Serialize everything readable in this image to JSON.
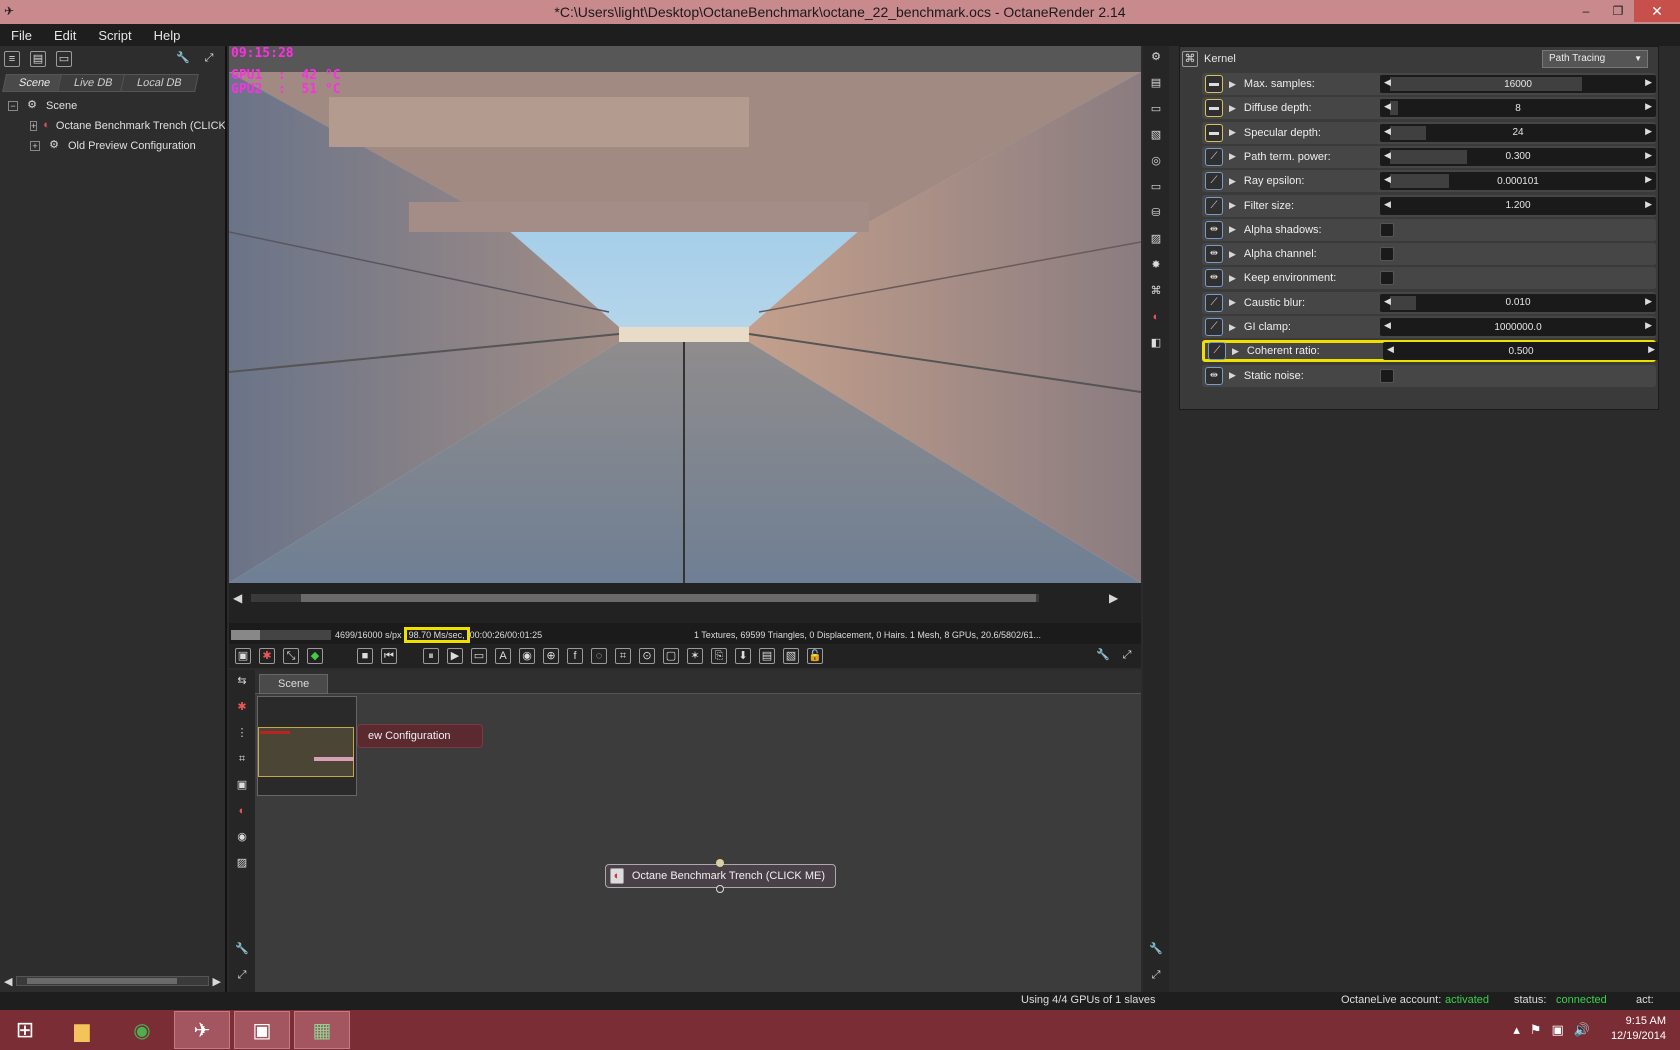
{
  "window": {
    "title": "*C:\\Users\\light\\Desktop\\OctaneBenchmark\\octane_22_benchmark.ocs - OctaneRender 2.14",
    "minimize": "‒",
    "maximize": "❐",
    "close": "✕"
  },
  "menu": [
    "File",
    "Edit",
    "Script",
    "Help"
  ],
  "left_panel": {
    "tabs": [
      "Scene",
      "Live DB",
      "Local DB"
    ],
    "tree": [
      {
        "expander": "−",
        "label": "Scene"
      },
      {
        "expander": "+",
        "label": "Octane Benchmark Trench (CLICK ME)"
      },
      {
        "expander": "+",
        "label": "Old Preview Configuration"
      }
    ]
  },
  "viewer": {
    "hud_time": "09:15:28",
    "hud_gpu1": "GPU1  :  42 °C",
    "hud_gpu2": "GPU2  :  51 °C",
    "progress": 0.294,
    "samples_text": "4699/16000 s/px",
    "speed_text": "98.70 Ms/sec,",
    "time_text": "00:00:26/00:01:25",
    "scene_stats": "1 Textures, 69599 Triangles, 0 Displacement, 0 Hairs. 1 Mesh, 8 GPUs, 20.6/5802/61..."
  },
  "node_graph": {
    "tab": "Scene",
    "node_preview_config": "ew Configuration",
    "node_main": "Octane Benchmark Trench (CLICK ME)"
  },
  "kernel": {
    "title": "Kernel",
    "type": "Path Tracing",
    "params": [
      {
        "label": "Max. samples:",
        "value": "16000",
        "fill": 0.75
      },
      {
        "label": "Diffuse depth:",
        "value": "8",
        "fill": 0.03
      },
      {
        "label": "Specular depth:",
        "value": "24",
        "fill": 0.14
      },
      {
        "label": "Path term. power:",
        "value": "0.300",
        "fill": 0.3
      },
      {
        "label": "Ray epsilon:",
        "value": "0.000101",
        "fill": 0.23
      },
      {
        "label": "Filter size:",
        "value": "1.200",
        "fill": 0.0
      },
      {
        "label": "Alpha shadows:",
        "value": ""
      },
      {
        "label": "Alpha channel:",
        "value": ""
      },
      {
        "label": "Keep environment:",
        "value": ""
      },
      {
        "label": "Caustic blur:",
        "value": "0.010",
        "fill": 0.1
      },
      {
        "label": "GI clamp:",
        "value": "1000000.0",
        "fill": 0.0
      },
      {
        "label": "Coherent ratio:",
        "value": "0.500",
        "fill": 0.0
      },
      {
        "label": "Static noise:",
        "value": ""
      }
    ]
  },
  "status_bar": {
    "gpus": "Using 4/4 GPUs of 1 slaves",
    "account_label": "OctaneLive account:",
    "account_value": "activated",
    "status_label": "status:",
    "status_value": "connected",
    "act_label": "act:"
  },
  "taskbar": {
    "time": "9:15 AM",
    "date": "12/19/2014"
  },
  "colors": {
    "hud": "#ff2ee6",
    "highlight": "#f0e000",
    "status_green": "#39d14c",
    "titlebar": "#c98a8e",
    "taskbar": "#7a2d34"
  }
}
